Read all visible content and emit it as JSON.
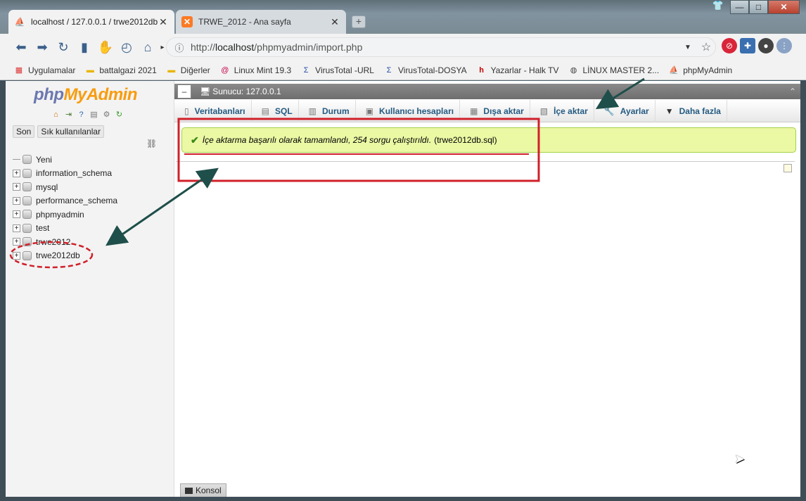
{
  "browser": {
    "tabs": [
      {
        "label": "localhost / 127.0.0.1 / trwe2012db",
        "close": "✕"
      },
      {
        "label": "TRWE_2012 - Ana sayfa",
        "close": "✕"
      }
    ],
    "new_tab": "+",
    "window_controls": {
      "minimize": "—",
      "maximize": "□",
      "close": "✕"
    },
    "url_prefix": "http://",
    "url_host": "localhost",
    "url_path": "/phpmyadmin/import.php"
  },
  "bookmarks": [
    {
      "label": "Uygulamalar",
      "icon": "apps-grid-icon"
    },
    {
      "label": "battalgazi 2021",
      "icon": "folder-icon"
    },
    {
      "label": "Diğerler",
      "icon": "folder-icon"
    },
    {
      "label": "Linux Mint 19.3",
      "icon": "debian-swirl-icon"
    },
    {
      "label": "VirusTotal -URL",
      "icon": "virustotal-icon"
    },
    {
      "label": "VirusTotal-DOSYA",
      "icon": "virustotal-icon"
    },
    {
      "label": "Yazarlar - Halk TV",
      "icon": "halktv-icon"
    },
    {
      "label": "LİNUX MASTER 2...",
      "icon": "globe-icon"
    },
    {
      "label": "phpMyAdmin",
      "icon": "pma-icon"
    }
  ],
  "sidebar": {
    "logo_part1": "php",
    "logo_part2": "MyAdmin",
    "tabs": [
      "Son",
      "Sık kullanılanlar"
    ],
    "databases": [
      {
        "name": "Yeni"
      },
      {
        "name": "information_schema"
      },
      {
        "name": "mysql"
      },
      {
        "name": "performance_schema"
      },
      {
        "name": "phpmyadmin"
      },
      {
        "name": "test"
      },
      {
        "name": "trwe2012"
      },
      {
        "name": "trwe2012db"
      }
    ]
  },
  "main": {
    "server_label": "Sunucu: 127.0.0.1",
    "tabs": [
      {
        "label": "Veritabanları",
        "icon": "database-icon"
      },
      {
        "label": "SQL",
        "icon": "sql-icon"
      },
      {
        "label": "Durum",
        "icon": "status-icon"
      },
      {
        "label": "Kullanıcı hesapları",
        "icon": "users-icon"
      },
      {
        "label": "Dışa aktar",
        "icon": "export-icon"
      },
      {
        "label": "İçe aktar",
        "icon": "import-icon"
      },
      {
        "label": "Ayarlar",
        "icon": "wrench-icon"
      },
      {
        "label": "Daha fazla",
        "icon": "caret-down-icon"
      }
    ],
    "success_message": "İçe aktarma başarılı olarak tamamlandı, 254 sorgu çalıştırıldı.",
    "success_file": "(trwe2012db.sql)",
    "console_label": "Konsol"
  },
  "colors": {
    "annotation_arrow": "#1f4f4a",
    "annotation_highlight": "#d0202a",
    "success_bg": "#ebf8a4",
    "tab_text": "#235a81"
  }
}
